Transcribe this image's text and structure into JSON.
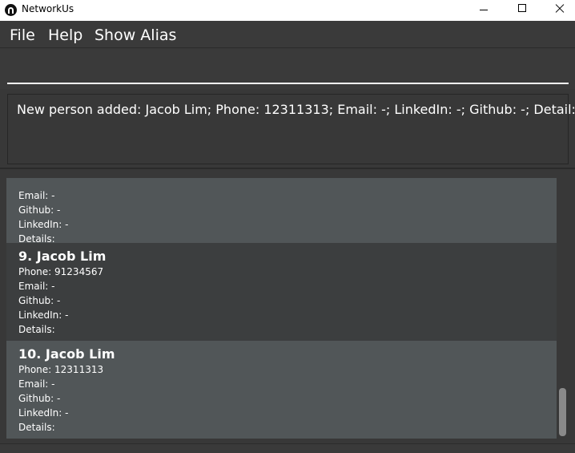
{
  "window": {
    "title": "NetworkUs"
  },
  "menu": {
    "file": "File",
    "help": "Help",
    "show_alias": "Show Alias"
  },
  "command": {
    "value": ""
  },
  "result": {
    "text": "New person added: Jacob Lim; Phone: 12311313; Email: -; LinkedIn: -; Github: -; Detail:"
  },
  "persons": [
    {
      "email": "Email: -",
      "github": "Github: -",
      "linkedin": "LinkedIn: -",
      "details": "Details:"
    },
    {
      "name": "9.  Jacob Lim",
      "phone": "Phone: 91234567",
      "email": "Email: -",
      "github": "Github: -",
      "linkedin": "LinkedIn: -",
      "details": "Details:"
    },
    {
      "name": "10.  Jacob Lim",
      "phone": "Phone: 12311313",
      "email": "Email: -",
      "github": "Github: -",
      "linkedin": "LinkedIn: -",
      "details": "Details:"
    }
  ]
}
